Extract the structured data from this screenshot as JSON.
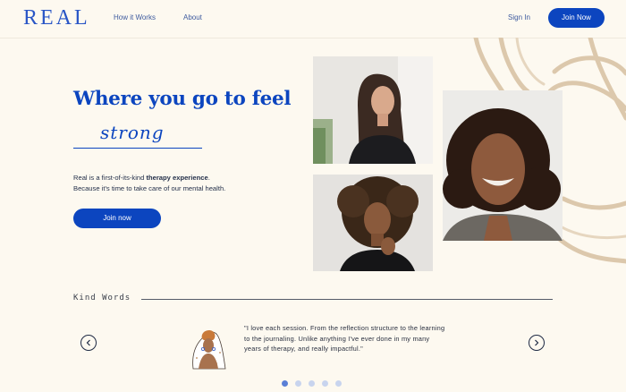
{
  "header": {
    "logo": "REAL",
    "nav": [
      "How it Works",
      "About"
    ],
    "sign_in": "Sign In",
    "join": "Join Now"
  },
  "hero": {
    "headline": "Where you go to feel",
    "script_word": "strong",
    "description_prefix": "Real is a first-of-its-kind ",
    "description_bold": "therapy experience",
    "description_suffix": ".",
    "description_line2": "Because it's time to take care of our mental health.",
    "cta": "Join now"
  },
  "testimonials": {
    "title": "Kind Words",
    "quote": "\"I love each session. From the reflection structure to the learning to the journaling. Unlike anything I've ever done in my many years of therapy, and really impactful.\"",
    "dot_count": 5,
    "active_dot": 0
  },
  "colors": {
    "brand_blue": "#0c45bf",
    "background": "#fdf9f0",
    "decor_tan": "#dcc8ac"
  }
}
